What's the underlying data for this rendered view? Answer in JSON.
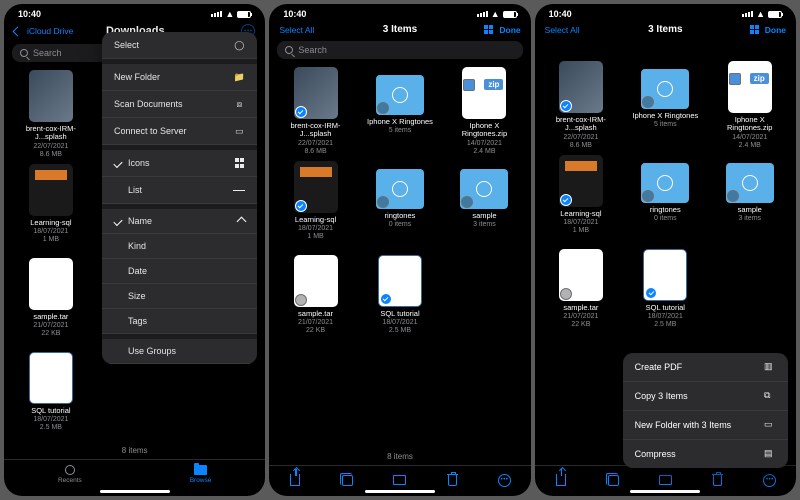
{
  "status": {
    "time": "10:40"
  },
  "accent": "#0a84ff",
  "screen1": {
    "back": "iCloud Drive",
    "title": "Downloads",
    "search_placeholder": "Search",
    "footer": "8 items",
    "tabs": {
      "recents": "Recents",
      "browse": "Browse"
    },
    "files": [
      {
        "name": "brent-cox-IRM-J...splash",
        "date": "22/07/2021",
        "size": "8.6 MB",
        "thumb": "img1"
      },
      {
        "name": "Learning-sql",
        "date": "18/07/2021",
        "size": "1 MB",
        "thumb": "img2"
      },
      {
        "name": "sample.tar",
        "date": "21/07/2021",
        "size": "22 KB",
        "thumb": "doc"
      },
      {
        "name": "SQL tutorial",
        "date": "18/07/2021",
        "size": "2.5 MB",
        "thumb": "sql"
      }
    ],
    "menu": {
      "select": "Select",
      "new_folder": "New Folder",
      "scan": "Scan Documents",
      "connect": "Connect to Server",
      "icons": "Icons",
      "list": "List",
      "name": "Name",
      "kind": "Kind",
      "date": "Date",
      "size": "Size",
      "tags": "Tags",
      "groups": "Use Groups"
    }
  },
  "screen2": {
    "select_all": "Select All",
    "title": "3 Items",
    "done": "Done",
    "search_placeholder": "Search",
    "footer": "8 items",
    "files": [
      {
        "name": "brent-cox-IRM-J...splash",
        "meta1": "22/07/2021",
        "meta2": "8.6 MB",
        "thumb": "img1",
        "selected": true
      },
      {
        "name": "Iphone X Ringtones",
        "meta1": "5 items",
        "meta2": "",
        "thumb": "folder",
        "selected": false
      },
      {
        "name": "Iphone X Ringtones.zip",
        "meta1": "14/07/2021",
        "meta2": "2.4 MB",
        "thumb": "zip",
        "selected": false
      },
      {
        "name": "Learning-sql",
        "meta1": "18/07/2021",
        "meta2": "1 MB",
        "thumb": "img2",
        "selected": true
      },
      {
        "name": "ringtones",
        "meta1": "0 items",
        "meta2": "",
        "thumb": "folder",
        "selected": false
      },
      {
        "name": "sample",
        "meta1": "3 items",
        "meta2": "",
        "thumb": "folder",
        "selected": false
      },
      {
        "name": "sample.tar",
        "meta1": "21/07/2021",
        "meta2": "22 KB",
        "thumb": "doc",
        "selected": false
      },
      {
        "name": "SQL tutorial",
        "meta1": "18/07/2021",
        "meta2": "2.5 MB",
        "thumb": "sql",
        "selected": true
      }
    ]
  },
  "screen3": {
    "select_all": "Select All",
    "title": "3 Items",
    "done": "Done",
    "files": [
      {
        "name": "brent-cox-IRM-J...splash",
        "meta1": "22/07/2021",
        "meta2": "8.6 MB",
        "thumb": "img1",
        "selected": true
      },
      {
        "name": "Iphone X Ringtones",
        "meta1": "5 items",
        "meta2": "",
        "thumb": "folder",
        "selected": false
      },
      {
        "name": "Iphone X Ringtones.zip",
        "meta1": "14/07/2021",
        "meta2": "2.4 MB",
        "thumb": "zip",
        "selected": false
      },
      {
        "name": "Learning-sql",
        "meta1": "18/07/2021",
        "meta2": "1 MB",
        "thumb": "img2",
        "selected": true
      },
      {
        "name": "ringtones",
        "meta1": "0 items",
        "meta2": "",
        "thumb": "folder",
        "selected": false
      },
      {
        "name": "sample",
        "meta1": "3 items",
        "meta2": "",
        "thumb": "folder",
        "selected": false
      },
      {
        "name": "sample.tar",
        "meta1": "21/07/2021",
        "meta2": "22 KB",
        "thumb": "doc",
        "selected": false
      },
      {
        "name": "SQL tutorial",
        "meta1": "18/07/2021",
        "meta2": "2.5 MB",
        "thumb": "sql",
        "selected": true
      }
    ],
    "ctx": {
      "pdf": "Create PDF",
      "copy": "Copy 3 Items",
      "folder": "New Folder with 3 Items",
      "compress": "Compress"
    }
  }
}
